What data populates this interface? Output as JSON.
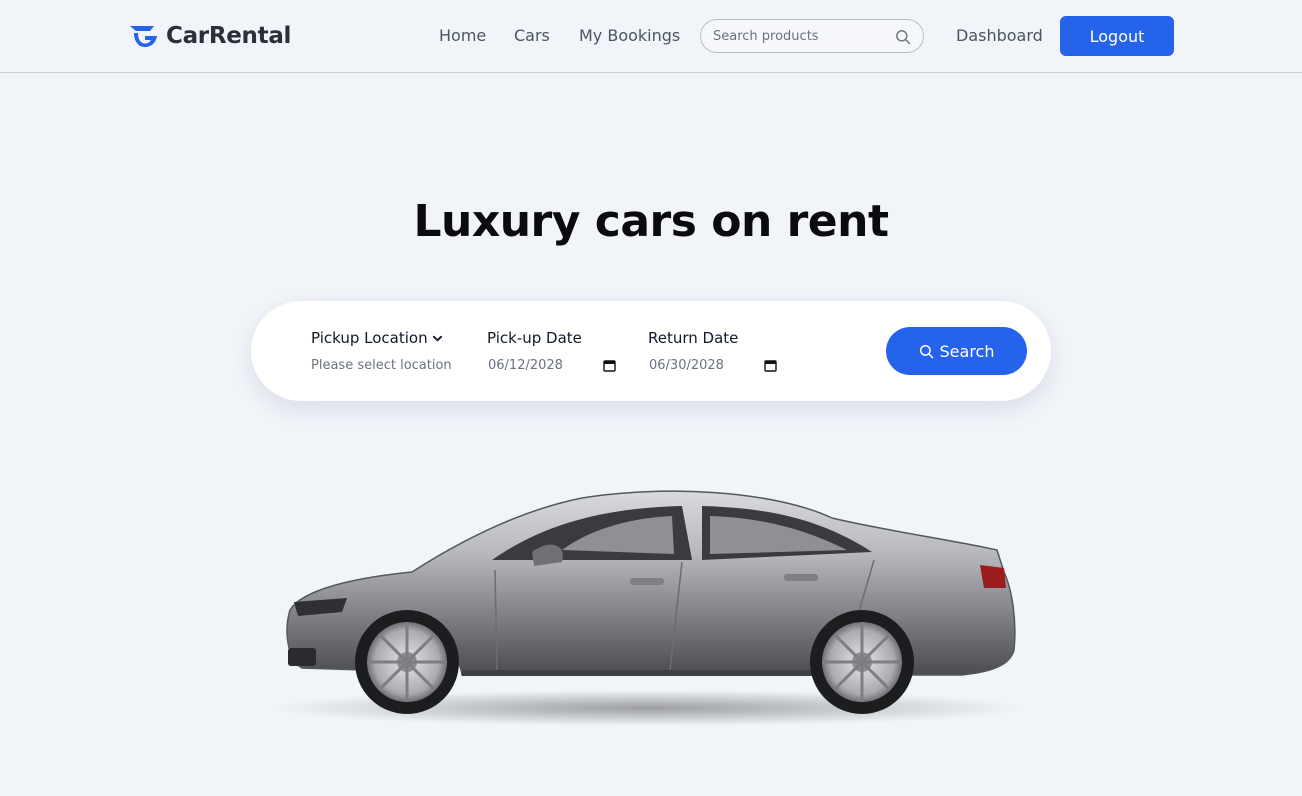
{
  "brand": {
    "name": "CarRental",
    "accent": "#2563eb"
  },
  "nav": {
    "home": "Home",
    "cars": "Cars",
    "bookings": "My Bookings",
    "search_placeholder": "Search products",
    "dashboard": "Dashboard",
    "logout": "Logout"
  },
  "hero": {
    "title": "Luxury cars on rent"
  },
  "booking": {
    "location_label": "Pickup Location",
    "location_placeholder": "Please select location",
    "pickup_label": "Pick-up Date",
    "pickup_value": "06/12/2028",
    "return_label": "Return Date",
    "return_value": "06/30/2028",
    "search_label": "Search"
  },
  "icons": {
    "logo": "car-rental-logo-icon",
    "nav_search": "search-icon",
    "location_chevron": "chevron-down-icon",
    "date": "calendar-icon",
    "search_button": "search-icon"
  },
  "image": {
    "subject": "silver-sedan-side-view"
  }
}
